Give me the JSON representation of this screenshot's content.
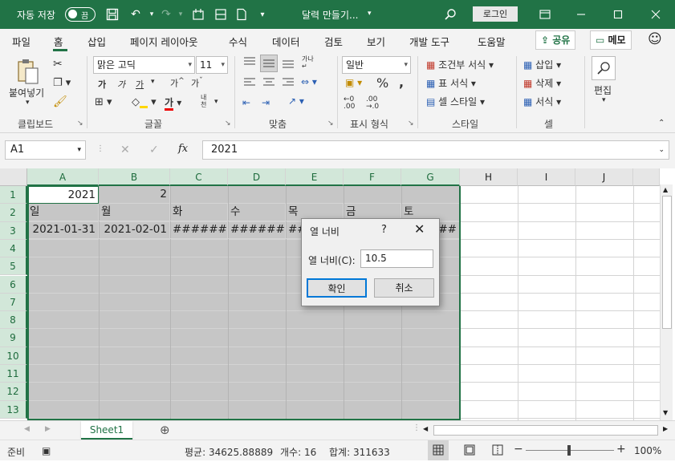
{
  "titlebar": {
    "autosave_label": "자동 저장",
    "autosave_state": "끔",
    "doc_title": "달력 만들기...",
    "login_label": "로그인"
  },
  "menu": {
    "items": [
      "파일",
      "홈",
      "삽입",
      "페이지 레이아웃",
      "수식",
      "데이터",
      "검토",
      "보기",
      "개발 도구",
      "도움말"
    ],
    "share_label": "공유",
    "memo_label": "메모"
  },
  "ribbon": {
    "clipboard": {
      "paste_label": "붙여넣기",
      "group_label": "클립보드"
    },
    "font": {
      "name": "맑은 고딕",
      "size": "11",
      "group_label": "글꼴",
      "bold": "가",
      "italic": "가",
      "underline": "가",
      "grow": "가",
      "shrink": "가",
      "color_btn": "가",
      "phonetic": "내천"
    },
    "align": {
      "group_label": "맞춤",
      "wrap": "가나"
    },
    "number": {
      "format": "일반",
      "group_label": "표시 형식"
    },
    "styles": {
      "conditional": "조건부 서식",
      "table": "표 서식",
      "cell": "셀 스타일",
      "group_label": "스타일"
    },
    "cells": {
      "insert": "삽입",
      "delete": "삭제",
      "format": "서식",
      "group_label": "셀"
    },
    "editing": {
      "label": "편집"
    }
  },
  "formula_bar": {
    "name_box": "A1",
    "fx_label": "fx",
    "formula": "2021"
  },
  "grid": {
    "columns": [
      "A",
      "B",
      "C",
      "D",
      "E",
      "F",
      "G",
      "H",
      "I",
      "J"
    ],
    "rows": [
      "1",
      "2",
      "3",
      "4",
      "5",
      "6",
      "7",
      "8",
      "9",
      "10",
      "11",
      "12",
      "13"
    ],
    "r1": {
      "a": "2021",
      "b": "2"
    },
    "r2": [
      "일",
      "월",
      "화",
      "수",
      "목",
      "금",
      "토"
    ],
    "r3": [
      "2021-01-31",
      "2021-02-01",
      "#######",
      "#######",
      "###",
      "",
      "###"
    ]
  },
  "dialog": {
    "title": "열 너비",
    "help": "?",
    "label": "열 너비(C):",
    "value": "10.5",
    "ok": "확인",
    "cancel": "취소"
  },
  "sheet": {
    "tab": "Sheet1"
  },
  "status": {
    "ready": "준비",
    "average": "평균: 34625.88889",
    "count": "개수: 16",
    "sum": "합계: 311633",
    "zoom": "100%"
  }
}
